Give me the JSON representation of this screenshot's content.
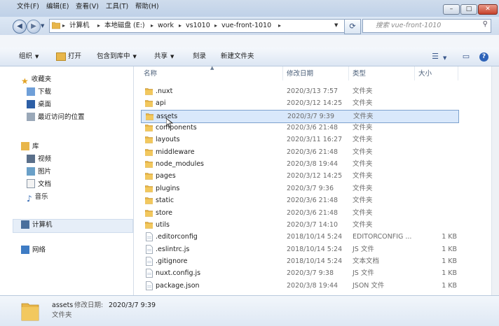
{
  "address": {
    "breadcrumbs": [
      "计算机",
      "本地磁盘 (E:)",
      "work",
      "vs1010",
      "vue-front-1010"
    ]
  },
  "search": {
    "placeholder": "搜索 vue-front-1010"
  },
  "menu": [
    "文件(F)",
    "编辑(E)",
    "查看(V)",
    "工具(T)",
    "帮助(H)"
  ],
  "toolbar": {
    "organize": "组织",
    "open": "打开",
    "include_in_library": "包含到库中",
    "share": "共享",
    "burn": "刻录",
    "new_folder": "新建文件夹"
  },
  "nav": {
    "favorites": "收藏夹",
    "favorites_items": [
      "下载",
      "桌面",
      "最近访问的位置"
    ],
    "libraries": "库",
    "libraries_items": [
      "视频",
      "图片",
      "文档",
      "音乐"
    ],
    "computer": "计算机",
    "network": "网络"
  },
  "columns": {
    "name": "名称",
    "modified": "修改日期",
    "type": "类型",
    "size": "大小"
  },
  "files": [
    {
      "name": ".nuxt",
      "modified": "2020/3/13 7:57",
      "type": "文件夹",
      "size": "",
      "kind": "folder"
    },
    {
      "name": "api",
      "modified": "2020/3/12 14:25",
      "type": "文件夹",
      "size": "",
      "kind": "folder"
    },
    {
      "name": "assets",
      "modified": "2020/3/7 9:39",
      "type": "文件夹",
      "size": "",
      "kind": "folder",
      "selected": true
    },
    {
      "name": "components",
      "modified": "2020/3/6 21:48",
      "type": "文件夹",
      "size": "",
      "kind": "folder"
    },
    {
      "name": "layouts",
      "modified": "2020/3/11 16:27",
      "type": "文件夹",
      "size": "",
      "kind": "folder"
    },
    {
      "name": "middleware",
      "modified": "2020/3/6 21:48",
      "type": "文件夹",
      "size": "",
      "kind": "folder"
    },
    {
      "name": "node_modules",
      "modified": "2020/3/8 19:44",
      "type": "文件夹",
      "size": "",
      "kind": "folder"
    },
    {
      "name": "pages",
      "modified": "2020/3/12 14:25",
      "type": "文件夹",
      "size": "",
      "kind": "folder"
    },
    {
      "name": "plugins",
      "modified": "2020/3/7 9:36",
      "type": "文件夹",
      "size": "",
      "kind": "folder"
    },
    {
      "name": "static",
      "modified": "2020/3/6 21:48",
      "type": "文件夹",
      "size": "",
      "kind": "folder"
    },
    {
      "name": "store",
      "modified": "2020/3/6 21:48",
      "type": "文件夹",
      "size": "",
      "kind": "folder"
    },
    {
      "name": "utils",
      "modified": "2020/3/7 14:10",
      "type": "文件夹",
      "size": "",
      "kind": "folder"
    },
    {
      "name": ".editorconfig",
      "modified": "2018/10/14 5:24",
      "type": "EDITORCONFIG ...",
      "size": "1 KB",
      "kind": "file"
    },
    {
      "name": ".eslintrc.js",
      "modified": "2018/10/14 5:24",
      "type": "JS 文件",
      "size": "1 KB",
      "kind": "file"
    },
    {
      "name": ".gitignore",
      "modified": "2018/10/14 5:24",
      "type": "文本文档",
      "size": "1 KB",
      "kind": "file"
    },
    {
      "name": "nuxt.config.js",
      "modified": "2020/3/7 9:38",
      "type": "JS 文件",
      "size": "1 KB",
      "kind": "file"
    },
    {
      "name": "package.json",
      "modified": "2020/3/8 19:44",
      "type": "JSON 文件",
      "size": "1 KB",
      "kind": "file"
    }
  ],
  "details": {
    "name": "assets",
    "modified_label": "修改日期:",
    "modified_value": "2020/3/7 9:39",
    "type": "文件夹"
  },
  "colors": {
    "folder": "#e8b64a",
    "selection": "#d9e8fb",
    "accent": "#2e63b8"
  }
}
